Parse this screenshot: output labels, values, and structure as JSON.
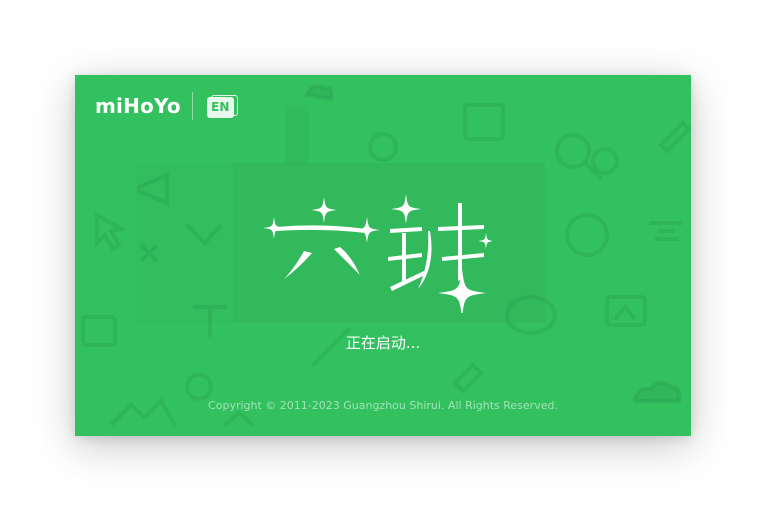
{
  "brand": {
    "name": "miHoYo",
    "language_badge": "EN"
  },
  "splash": {
    "logo_text": "六班",
    "status_text": "正在启动...",
    "copyright": "Copyright © 2011-2023 Guangzhou Shirui. All Rights Reserved."
  },
  "colors": {
    "background": "#33c05f",
    "text": "#ffffff"
  },
  "icons": [
    "cloud-icon",
    "window-icon",
    "pen-icon",
    "search-icon",
    "megaphone-icon",
    "cursor-icon",
    "compass-icon",
    "image-icon",
    "text-icon",
    "palette-icon",
    "brush-icon",
    "gamepad-icon",
    "mountain-icon"
  ]
}
